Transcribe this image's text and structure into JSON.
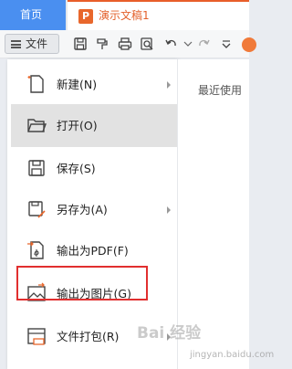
{
  "tabs": {
    "home_label": "首页",
    "doc_icon": "presentation-icon",
    "doc_icon_letter": "P",
    "doc_title": "演示文稿1"
  },
  "toolbar": {
    "file_label": "文件",
    "icons": [
      "save-icon",
      "format-painter-icon",
      "print-icon",
      "print-preview-icon",
      "undo-icon",
      "redo-dropdown-icon",
      "more-icon",
      "avatar"
    ]
  },
  "menu": {
    "items": [
      {
        "label": "新建(N)",
        "icon": "new-file-icon",
        "has_submenu": true
      },
      {
        "label": "打开(O)",
        "icon": "folder-open-icon",
        "has_submenu": false,
        "selected": true
      },
      {
        "label": "保存(S)",
        "icon": "save-icon",
        "has_submenu": false
      },
      {
        "label": "另存为(A)",
        "icon": "save-as-icon",
        "has_submenu": true
      },
      {
        "label": "输出为PDF(F)",
        "icon": "export-pdf-icon",
        "has_submenu": false,
        "highlighted": true
      },
      {
        "label": "输出为图片(G)",
        "icon": "export-image-icon",
        "has_submenu": false
      },
      {
        "label": "文件打包(R)",
        "icon": "package-icon",
        "has_submenu": true
      }
    ]
  },
  "panel": {
    "recent_label": "最近使用"
  },
  "watermark": {
    "text": "Bai 经验",
    "sub": "jingyan.baidu.com"
  },
  "colors": {
    "home_tab": "#4a8ff0",
    "doc_accent": "#e8672c",
    "highlight_box": "#e12f2f",
    "selected_row": "#e2e2e2"
  }
}
